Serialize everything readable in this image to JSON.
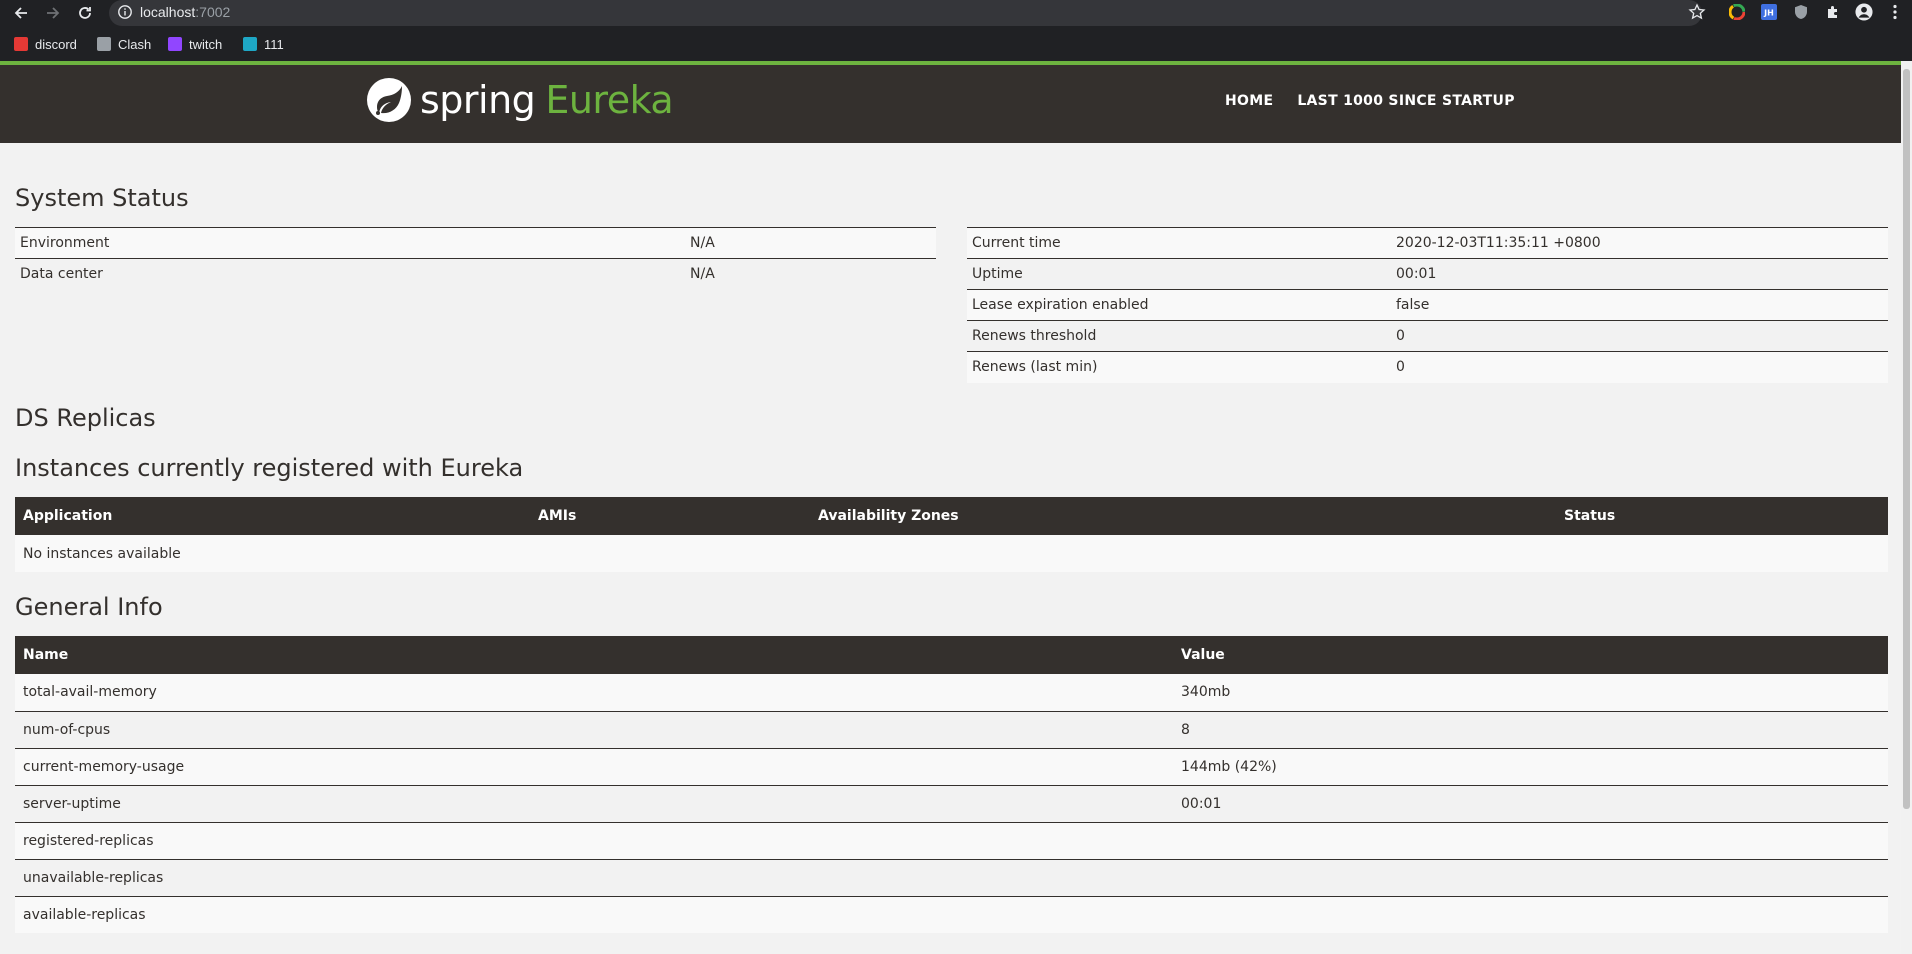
{
  "browser": {
    "url_host": "localhost",
    "url_port": ":7002",
    "bookmarks": [
      {
        "label": "discord",
        "icon": "discord-icon",
        "color": "#e53935"
      },
      {
        "label": "Clash",
        "icon": "clash-icon",
        "color": "#9aa0a6"
      },
      {
        "label": "twitch",
        "icon": "twitch-icon",
        "color": "#9146ff"
      },
      {
        "label": "111",
        "icon": "bookmark-111-icon",
        "color": "#1ea7c5"
      }
    ],
    "extensions": [
      "chrome-colors-icon",
      "jh-extension-icon",
      "shield-extension-icon",
      "puzzle-icon",
      "profile-icon",
      "menu-dots-icon"
    ]
  },
  "header": {
    "brand_spring": "spring",
    "brand_eureka": "Eureka",
    "nav": [
      "HOME",
      "LAST 1000 SINCE STARTUP"
    ],
    "accent_color": "#6db33f",
    "bar_color": "#34302d"
  },
  "system_status": {
    "title": "System Status",
    "left": [
      {
        "key": "Environment",
        "value": "N/A"
      },
      {
        "key": "Data center",
        "value": "N/A"
      }
    ],
    "right": [
      {
        "key": "Current time",
        "value": "2020-12-03T11:35:11 +0800"
      },
      {
        "key": "Uptime",
        "value": "00:01"
      },
      {
        "key": "Lease expiration enabled",
        "value": "false"
      },
      {
        "key": "Renews threshold",
        "value": "0"
      },
      {
        "key": "Renews (last min)",
        "value": "0"
      }
    ]
  },
  "ds_replicas": {
    "title": "DS Replicas"
  },
  "instances": {
    "title": "Instances currently registered with Eureka",
    "columns": [
      "Application",
      "AMIs",
      "Availability Zones",
      "Status"
    ],
    "empty_text": "No instances available"
  },
  "general_info": {
    "title": "General Info",
    "columns": [
      "Name",
      "Value"
    ],
    "rows": [
      {
        "name": "total-avail-memory",
        "value": "340mb"
      },
      {
        "name": "num-of-cpus",
        "value": "8"
      },
      {
        "name": "current-memory-usage",
        "value": "144mb (42%)"
      },
      {
        "name": "server-uptime",
        "value": "00:01"
      },
      {
        "name": "registered-replicas",
        "value": ""
      },
      {
        "name": "unavailable-replicas",
        "value": ""
      },
      {
        "name": "available-replicas",
        "value": ""
      }
    ]
  }
}
